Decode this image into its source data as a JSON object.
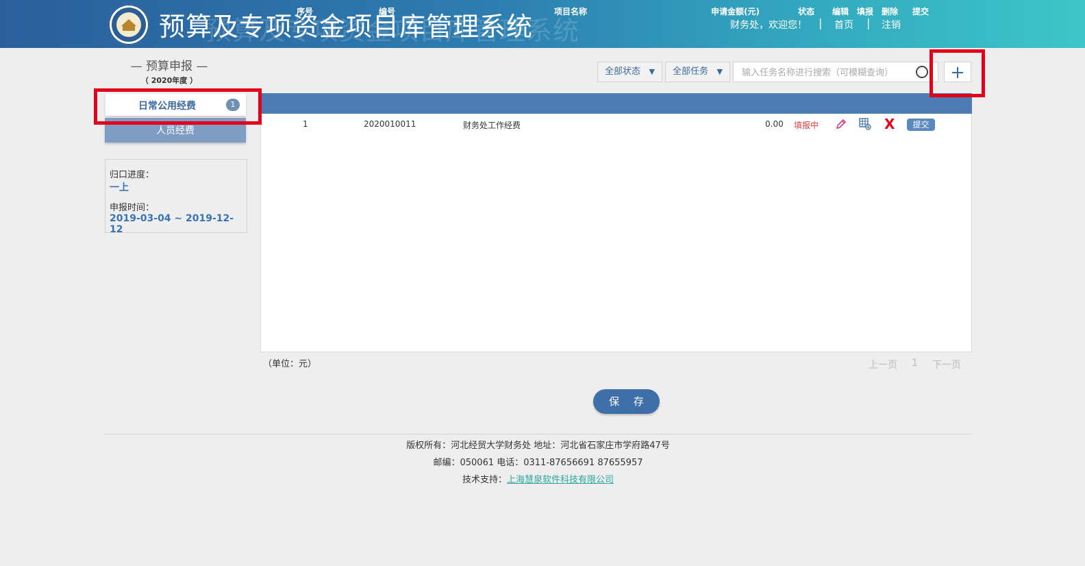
{
  "header": {
    "title": "预算及专项资金项目库管理系统",
    "title_echo": "预算及专项资金项目库管理系统",
    "welcome": "财务处，欢迎您！",
    "sep": "|",
    "home": "首页",
    "logout": "注销"
  },
  "sidebar": {
    "section_title": "— 预算申报 —",
    "year": "（ 2020年度 ）",
    "tabs": [
      {
        "label": "日常公用经费",
        "badge": "1"
      },
      {
        "label": "人员经费"
      }
    ],
    "info": {
      "progress_label": "归口进度：",
      "progress_value": "一上",
      "time_label": "申报时间：",
      "time_value": "2019-03-04 ~ 2019-12-12"
    }
  },
  "toolbar": {
    "status_filter": "全部状态",
    "task_filter": "全部任务",
    "search_placeholder": "输入任务名称进行搜索（可模糊查询）",
    "dropdown_arrow": "▼"
  },
  "table": {
    "columns": [
      "序号",
      "编号",
      "项目名称",
      "申请金额(元)",
      "状态",
      "编辑",
      "填报",
      "删除",
      "提交"
    ],
    "rows": [
      {
        "index": "1",
        "code": "2020010011",
        "name": "财务处工作经费",
        "amount": "0.00",
        "status": "填报中",
        "submit_label": "提交",
        "delete_glyph": "X"
      }
    ]
  },
  "footer_bar": {
    "unit": "（单位：元）",
    "prev": "上一页",
    "page": "1",
    "next": "下一页",
    "save": "保 存"
  },
  "footer": {
    "line1": "版权所有：河北经贸大学财务处 地址：河北省石家庄市学府路47号",
    "line2": "邮编：050061 电话：0311-87656691 87655957",
    "support_label": "技术支持：",
    "support_link": "上海慧泉软件科技有限公司"
  },
  "colors": {
    "header_start": "#2a5f9c",
    "header_end": "#3cc6c8",
    "table_header": "#4d7cb3",
    "accent": "#3c6a9e",
    "status_red": "#e03c3c",
    "highlight_red": "#e3001b",
    "link_teal": "#2aa6a0"
  },
  "icons": [
    "logo-emblem",
    "search-icon",
    "plus-icon",
    "pencil-icon",
    "table-edit-icon",
    "delete-icon"
  ]
}
